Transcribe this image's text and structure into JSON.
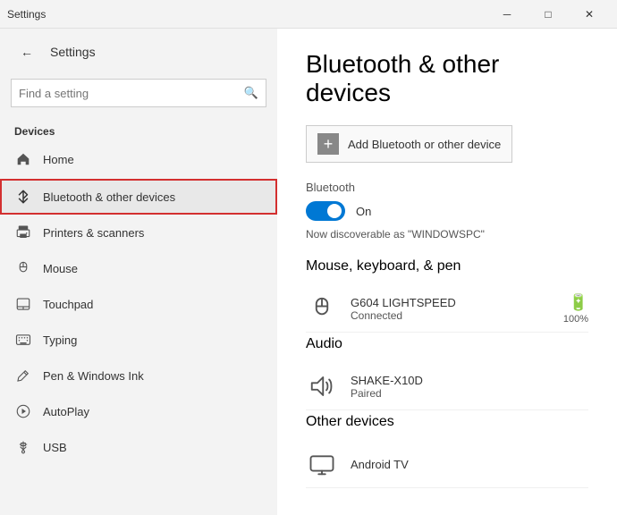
{
  "titleBar": {
    "title": "Settings",
    "minimizeLabel": "─",
    "maximizeLabel": "□",
    "closeLabel": "✕"
  },
  "sidebar": {
    "backArrow": "←",
    "appTitle": "Settings",
    "search": {
      "placeholder": "Find a setting",
      "icon": "🔍"
    },
    "sectionLabel": "Devices",
    "items": [
      {
        "id": "home",
        "label": "Home",
        "icon": "⌂",
        "active": false
      },
      {
        "id": "bluetooth",
        "label": "Bluetooth & other devices",
        "icon": "B",
        "active": true
      },
      {
        "id": "printers",
        "label": "Printers & scanners",
        "icon": "P",
        "active": false
      },
      {
        "id": "mouse",
        "label": "Mouse",
        "icon": "M",
        "active": false
      },
      {
        "id": "touchpad",
        "label": "Touchpad",
        "icon": "T",
        "active": false
      },
      {
        "id": "typing",
        "label": "Typing",
        "icon": "K",
        "active": false
      },
      {
        "id": "pen",
        "label": "Pen & Windows Ink",
        "icon": "✏",
        "active": false
      },
      {
        "id": "autoplay",
        "label": "AutoPlay",
        "icon": "▶",
        "active": false
      },
      {
        "id": "usb",
        "label": "USB",
        "icon": "U",
        "active": false
      }
    ]
  },
  "rightPanel": {
    "pageTitle": "Bluetooth & other devices",
    "addDeviceLabel": "Add Bluetooth or other device",
    "bluetoothSection": {
      "label": "Bluetooth",
      "toggleState": "On",
      "discoverableText": "Now discoverable as \"WINDOWSPC\""
    },
    "categories": [
      {
        "id": "mouse-keyboard-pen",
        "title": "Mouse, keyboard, & pen",
        "devices": [
          {
            "name": "G604 LIGHTSPEED",
            "status": "Connected",
            "hasBattery": true,
            "batteryLevel": "100%"
          }
        ]
      },
      {
        "id": "audio",
        "title": "Audio",
        "devices": [
          {
            "name": "SHAKE-X10D",
            "status": "Paired",
            "hasBattery": false
          }
        ]
      },
      {
        "id": "other-devices",
        "title": "Other devices",
        "devices": [
          {
            "name": "Android TV",
            "status": "",
            "hasBattery": false
          }
        ]
      }
    ]
  }
}
